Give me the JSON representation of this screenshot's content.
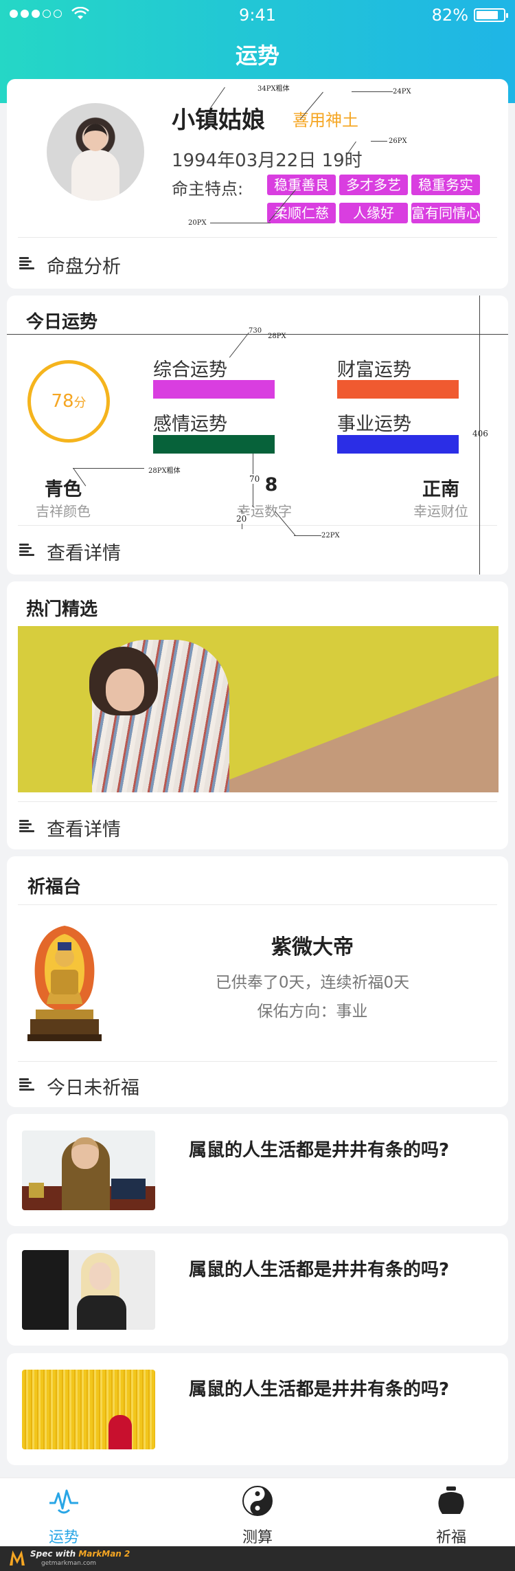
{
  "status": {
    "time": "9:41",
    "battery": "82%",
    "battery_level": 0.82
  },
  "header": {
    "title": "运势"
  },
  "profile": {
    "name": "小镇姑娘",
    "god": "喜用神土",
    "birth": "1994年03月22日  19时",
    "traits_label": "命主特点:",
    "traits": [
      "稳重善良",
      "多才多艺",
      "稳重务实",
      "柔顺仁慈",
      "人缘好",
      "富有同情心"
    ],
    "footer": "命盘分析"
  },
  "today": {
    "title": "今日运势",
    "score": "78",
    "score_unit": "分",
    "items": [
      {
        "label": "综合运势",
        "color": "#d93ee0"
      },
      {
        "label": "财富运势",
        "color": "#f05a30"
      },
      {
        "label": "感情运势",
        "color": "#07623a"
      },
      {
        "label": "事业运势",
        "color": "#2b2ee6"
      }
    ],
    "lucky": [
      {
        "value": "青色",
        "caption": "吉祥颜色"
      },
      {
        "value": "8",
        "caption": "幸运数字"
      },
      {
        "value": "正南",
        "caption": "幸运财位"
      }
    ],
    "footer": "查看详情"
  },
  "annotations": {
    "a1": "34PX粗体",
    "a2": "24PX",
    "a3": "26PX",
    "a4": "20PX",
    "a5": "730",
    "a6": "28PX",
    "a7": "406",
    "a8": "28PX粗体",
    "a9": "70",
    "a10": "20",
    "a11": "22PX"
  },
  "hot": {
    "title": "热门精选",
    "footer": "查看详情"
  },
  "prayer": {
    "title": "祈福台",
    "deity": "紫微大帝",
    "line1": "已供奉了0天，连续祈福0天",
    "line2": "保佑方向：事业",
    "footer": "今日未祈福"
  },
  "articles": [
    {
      "title": "属鼠的人生活都是井井有条的吗?"
    },
    {
      "title": "属鼠的人生活都是井井有条的吗?"
    },
    {
      "title": "属鼠的人生活都是井井有条的吗?"
    }
  ],
  "tabs": [
    {
      "label": "运势",
      "active": true
    },
    {
      "label": "测算",
      "active": false
    },
    {
      "label": "祈福",
      "active": false
    }
  ],
  "colors": {
    "accent": "#29a6e6",
    "header_start": "#25d7c6",
    "header_end": "#1fb5e6",
    "tag": "#d93ee0",
    "score": "#f5a623"
  },
  "markman": {
    "text_a": "Spec with ",
    "text_b": "MarkMan 2",
    "site": "getmarkman.com"
  }
}
